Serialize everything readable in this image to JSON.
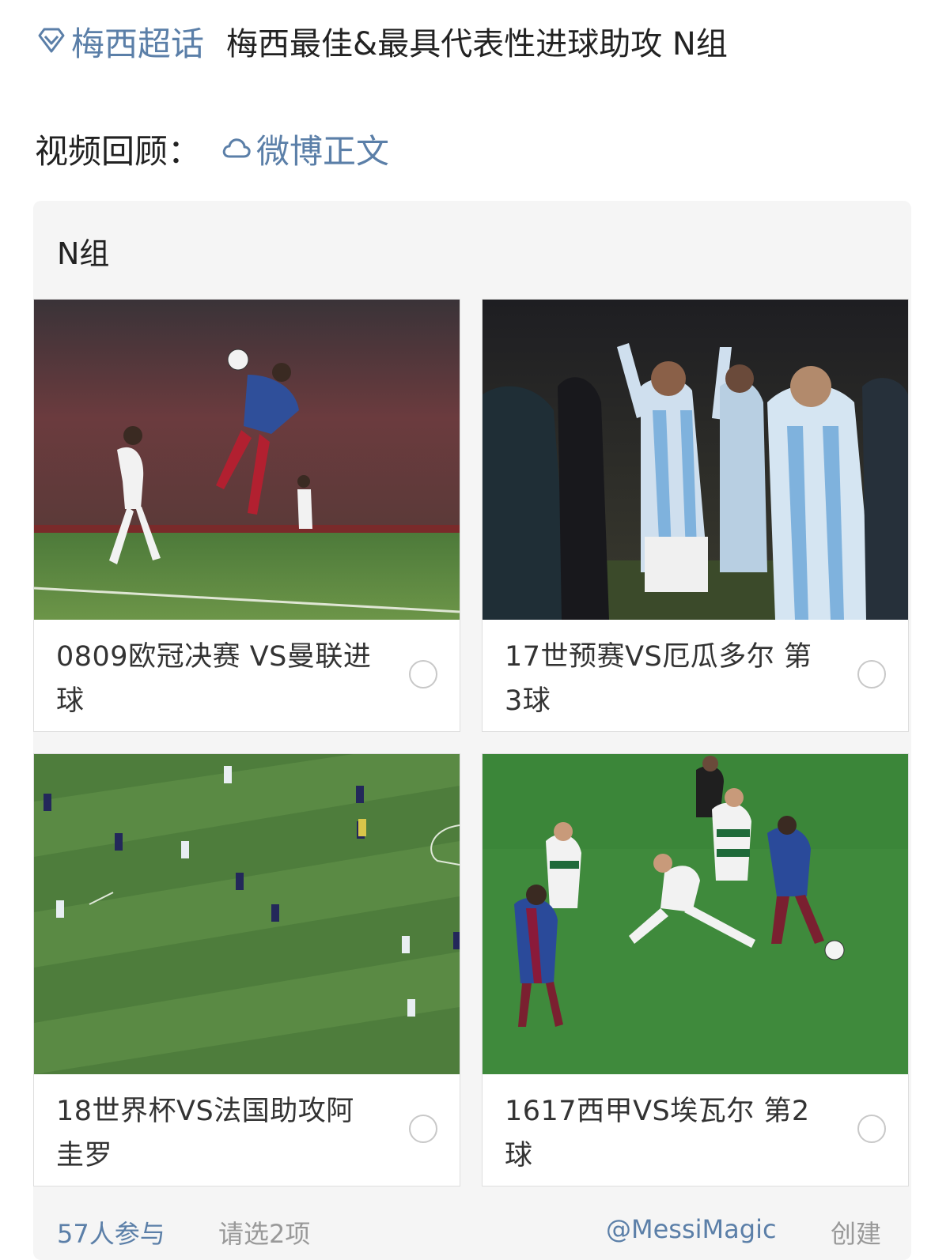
{
  "header": {
    "topic_label": "梅西超话",
    "post_title": "梅西最佳&最具代表性进球助攻 N组"
  },
  "video": {
    "label": "视频回顾：",
    "link_label": "微博正文"
  },
  "poll": {
    "group_title": "N组",
    "options": [
      {
        "label": "0809欧冠决赛 VS曼联进球",
        "photo": "messi-header-vs-man-united-photo"
      },
      {
        "label": "17世预赛VS厄瓜多尔 第3球",
        "photo": "argentina-celebration-photo"
      },
      {
        "label": "18世界杯VS法国助攻阿圭罗",
        "photo": "world-cup-pitch-photo"
      },
      {
        "label": "1617西甲VS埃瓦尔 第2球",
        "photo": "messi-dribble-vs-eibar-photo"
      }
    ],
    "footer": {
      "participants": "57人参与",
      "hint": "请选2项",
      "creator": "@MessiMagic",
      "created_label": "创建"
    }
  },
  "colors": {
    "link": "#5b7fa8",
    "card_bg": "#f5f5f5",
    "muted": "#999999"
  }
}
